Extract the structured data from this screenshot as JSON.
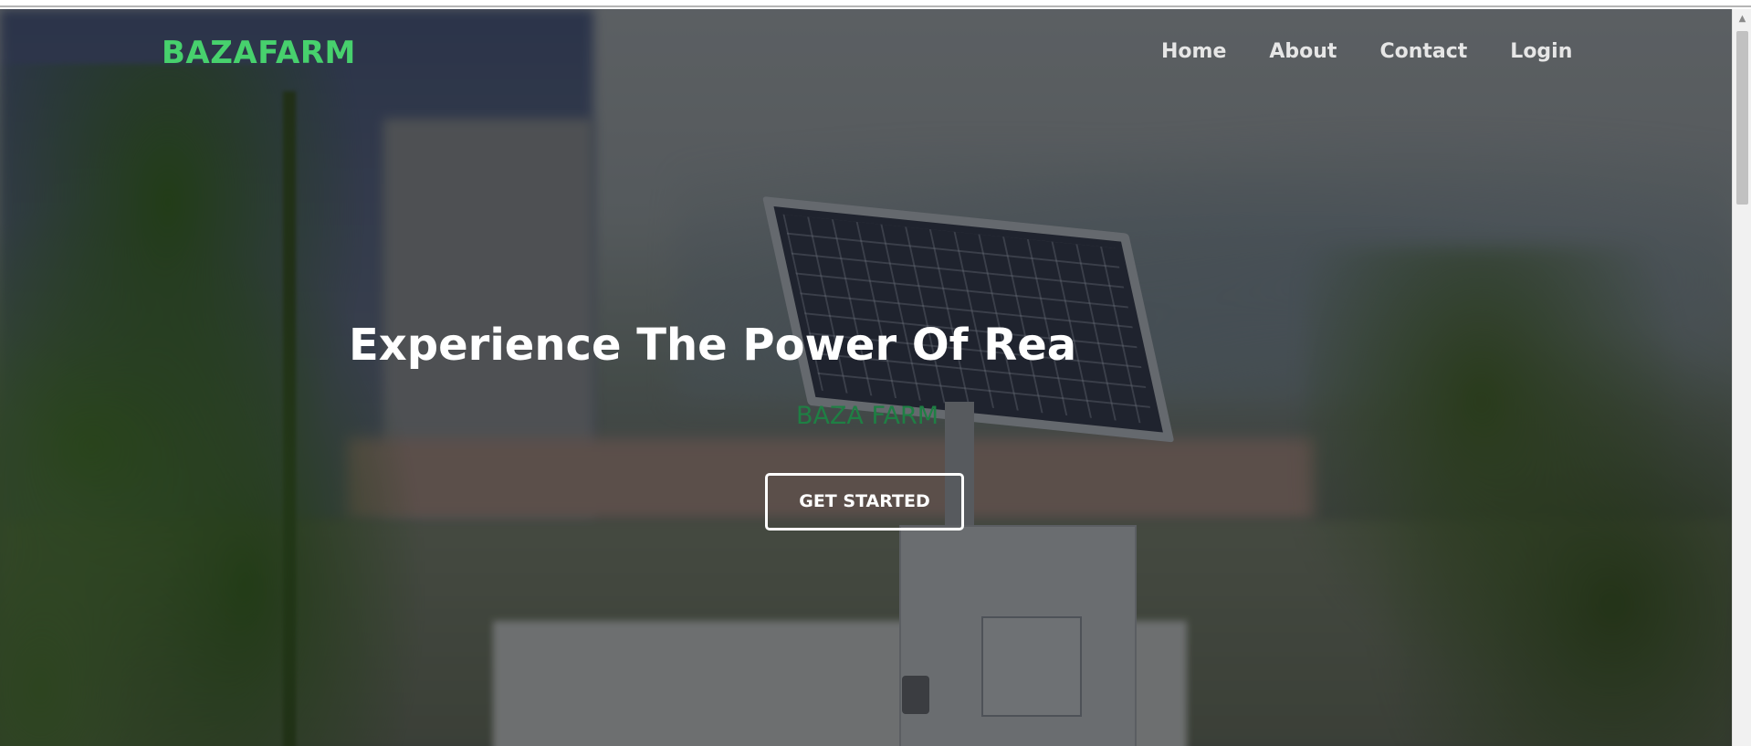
{
  "header": {
    "brand": "BAZAFARM",
    "nav": [
      "Home",
      "About",
      "Contact",
      "Login"
    ]
  },
  "hero": {
    "headline": "Experience The Power Of Real-Ti",
    "subtitle": "BAZA FARM",
    "cta_label": "GET STARTED"
  },
  "colors": {
    "brand": "#47d16d",
    "subtitle": "#1f7f44",
    "nav_text": "#e6e6e6",
    "overlay": "rgba(0,0,0,0.45)"
  },
  "icons": {
    "scroll_up": "scroll-up-arrow-icon"
  }
}
